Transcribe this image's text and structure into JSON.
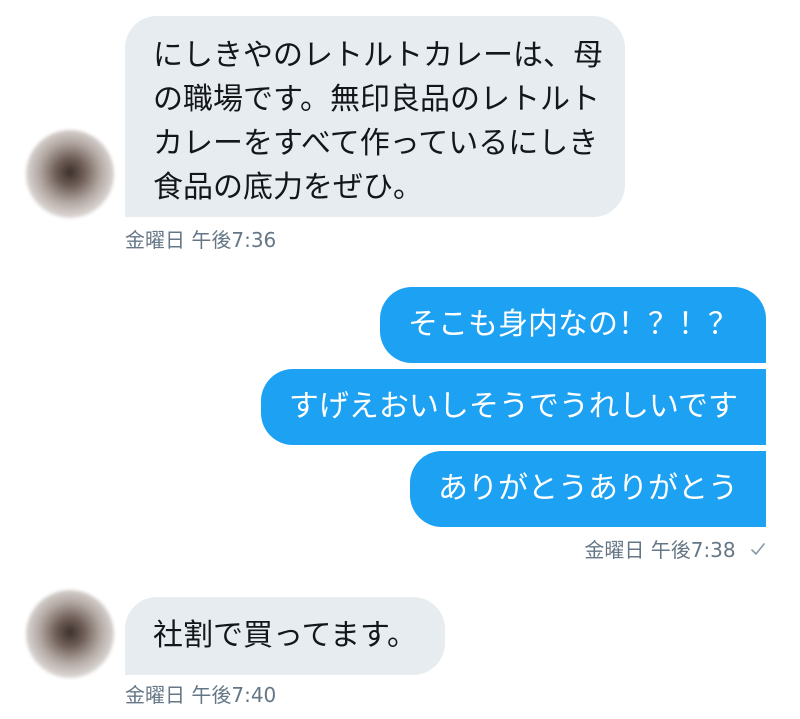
{
  "messages": [
    {
      "lines": [
        "にしきやのレトルトカレーは、母",
        "の職場です。無印良品のレトルト",
        "カレーをすべて作っているにしき",
        "食品の底力をぜひ。"
      ]
    },
    {
      "text": "そこも身内なの！？！？"
    },
    {
      "text": "すげえおいしそうでうれしいです"
    },
    {
      "text": "ありがとうありがとう"
    },
    {
      "text": "社割で買ってます。"
    }
  ],
  "timestamps": {
    "first": "金曜日 午後7:36",
    "second": "金曜日 午後7:38",
    "third": "金曜日 午後7:40"
  },
  "icons": {
    "read": "check-icon"
  },
  "colors": {
    "sent_bubble": "#1da1f2",
    "received_bubble": "#e6ecf0",
    "meta_text": "#657786"
  }
}
